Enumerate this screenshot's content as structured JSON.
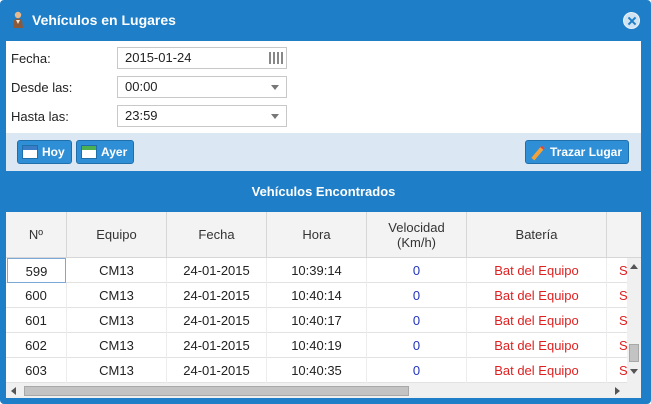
{
  "window": {
    "title": "Vehículos en Lugares",
    "icon": "person-icon",
    "close_icon": "close-icon"
  },
  "form": {
    "fecha_label": "Fecha:",
    "fecha_value": "2015-01-24",
    "desde_label": "Desde las:",
    "desde_value": "00:00",
    "hasta_label": "Hasta las:",
    "hasta_value": "23:59"
  },
  "toolbar": {
    "hoy_label": "Hoy",
    "ayer_label": "Ayer",
    "trazar_label": "Trazar Lugar"
  },
  "grid": {
    "title": "Vehículos Encontrados",
    "columns": [
      "Nº",
      "Equipo",
      "Fecha",
      "Hora",
      "Velocidad (Km/h)",
      "Batería",
      ""
    ],
    "rows": [
      {
        "num": "599",
        "equipo": "CM13",
        "fecha": "24-01-2015",
        "hora": "10:39:14",
        "velocidad": "0",
        "bateria": "Bat del Equipo",
        "extra": "S"
      },
      {
        "num": "600",
        "equipo": "CM13",
        "fecha": "24-01-2015",
        "hora": "10:40:14",
        "velocidad": "0",
        "bateria": "Bat del Equipo",
        "extra": "S"
      },
      {
        "num": "601",
        "equipo": "CM13",
        "fecha": "24-01-2015",
        "hora": "10:40:17",
        "velocidad": "0",
        "bateria": "Bat del Equipo",
        "extra": "S"
      },
      {
        "num": "602",
        "equipo": "CM13",
        "fecha": "24-01-2015",
        "hora": "10:40:19",
        "velocidad": "0",
        "bateria": "Bat del Equipo",
        "extra": "S"
      },
      {
        "num": "603",
        "equipo": "CM13",
        "fecha": "24-01-2015",
        "hora": "10:40:35",
        "velocidad": "0",
        "bateria": "Bat del Equipo",
        "extra": "S"
      }
    ]
  },
  "colors": {
    "accent": "#1e7fc8",
    "battery_text": "#e02020",
    "speed_text": "#2233bb"
  }
}
